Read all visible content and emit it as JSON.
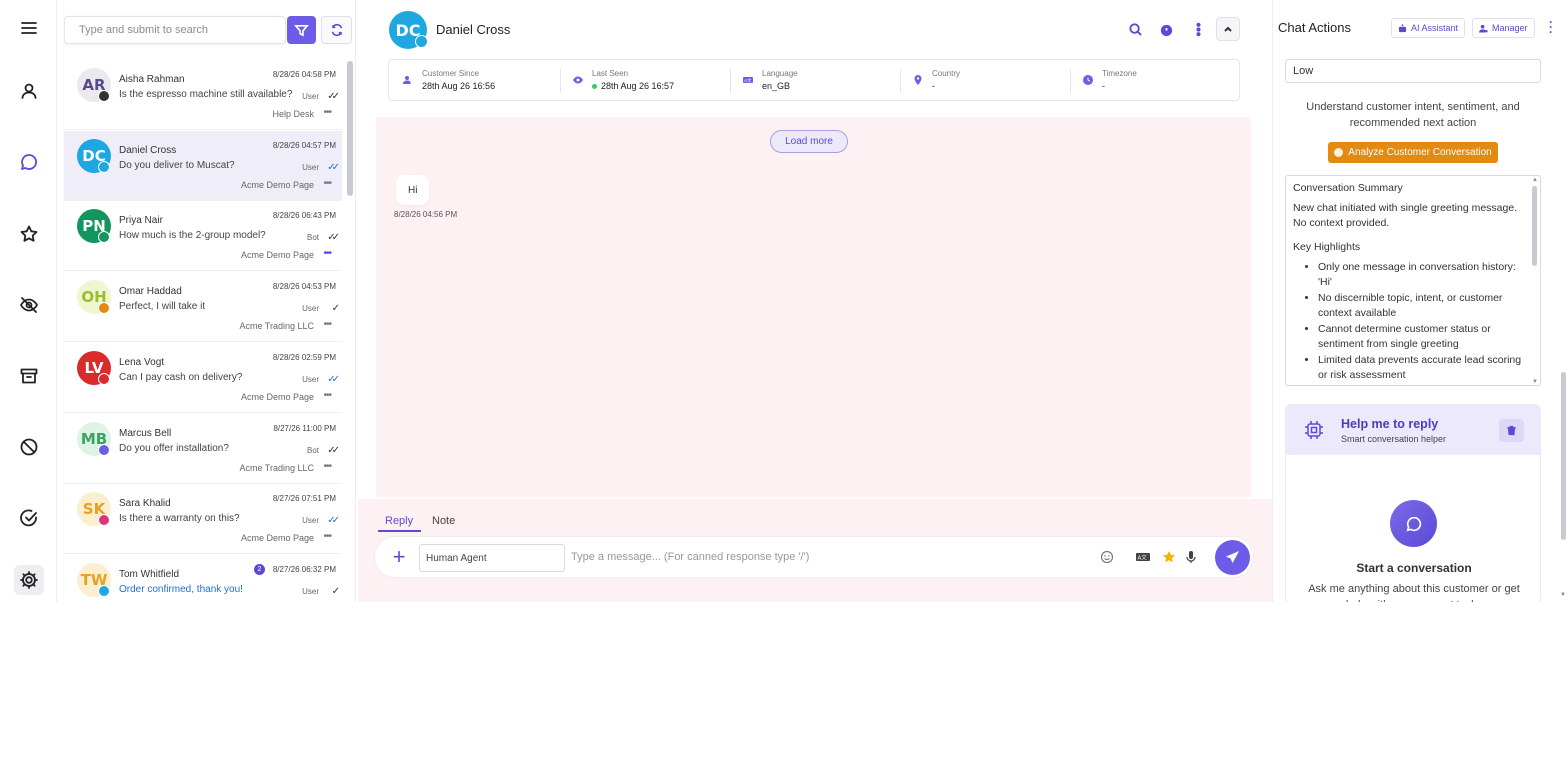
{
  "nav": {
    "items": [
      "menu-icon",
      "contacts-icon",
      "chats-icon",
      "starred-icon",
      "hidden-icon",
      "archive-icon",
      "blocked-icon",
      "resolved-icon",
      "settings-icon"
    ]
  },
  "search": {
    "placeholder": "Type and submit to search"
  },
  "conversations": [
    {
      "initials": "AR",
      "name": "Aisha Rahman",
      "time": "8/28/26 04:58 PM",
      "message": "Is the espresso machine still available?",
      "sender": "User",
      "ticks": "✓✓",
      "source": "Help Desk",
      "avatar_bg": "#e9e9ee",
      "avatar_fg": "#5b4a8a",
      "badge_bg": "#333333",
      "badge": "AR"
    },
    {
      "initials": "DC",
      "name": "Daniel Cross",
      "time": "8/28/26 04:57 PM",
      "message": "Do you deliver to Muscat?",
      "sender": "User",
      "ticks": "✓✓",
      "source": "Acme Demo Page",
      "avatar_bg": "#1ea7e0",
      "avatar_fg": "#ffffff",
      "badge_bg": "#1ea7e0",
      "badge": "DC"
    },
    {
      "initials": "PN",
      "name": "Priya Nair",
      "time": "8/28/26 06:43 PM",
      "message": "How much is the 2-group model?",
      "sender": "Bot",
      "ticks": "✓✓",
      "source": "Acme Demo Page",
      "avatar_bg": "#13955e",
      "avatar_fg": "#ffffff",
      "badge_bg": "#13955e",
      "badge": "PN"
    },
    {
      "initials": "OH",
      "name": "Omar Haddad",
      "time": "8/28/26 04:53 PM",
      "message": "Perfect, I will take it",
      "sender": "User",
      "ticks": "✓",
      "source": "Acme Trading LLC",
      "avatar_bg": "#eef7cf",
      "avatar_fg": "#9bbf2c",
      "badge_bg": "#e38a12",
      "badge": "OH"
    },
    {
      "initials": "LV",
      "name": "Lena Vogt",
      "time": "8/28/26 02:59 PM",
      "message": "Can I pay cash on delivery?",
      "sender": "User",
      "ticks": "✓✓",
      "source": "Acme Demo Page",
      "avatar_bg": "#d92b2b",
      "avatar_fg": "#ffffff",
      "badge_bg": "#d92b2b",
      "badge": "LV"
    },
    {
      "initials": "MB",
      "name": "Marcus Bell",
      "time": "8/27/26 11:00 PM",
      "message": "Do you offer installation?",
      "sender": "Bot",
      "ticks": "✓✓",
      "source": "Acme Trading LLC",
      "avatar_bg": "#dff2e6",
      "avatar_fg": "#3aa35f",
      "badge_bg": "#6c5ce7",
      "badge": "MB"
    },
    {
      "initials": "SK",
      "name": "Sara Khalid",
      "time": "8/27/26 07:51 PM",
      "message": "Is there a warranty on this?",
      "sender": "User",
      "ticks": "✓✓",
      "source": "Acme Demo Page",
      "avatar_bg": "#fcefcf",
      "avatar_fg": "#e5a224",
      "badge_bg": "#d9367a",
      "badge": "SK"
    },
    {
      "initials": "TW",
      "name": "Tom Whitfield",
      "time": "8/27/26 06:32 PM",
      "message": "Order confirmed, thank you!",
      "sender": "User",
      "ticks": "✓",
      "source": "",
      "avatar_bg": "#fcefcf",
      "avatar_fg": "#e5a224",
      "badge_bg": "#1ea7e0",
      "badge": "TW",
      "unread": "2"
    }
  ],
  "chat": {
    "initials": "DC",
    "name": "Daniel Cross",
    "info": {
      "customer_since_label": "Customer Since",
      "customer_since": "28th Aug 26 16:56",
      "last_seen_label": "Last Seen",
      "last_seen": "28th Aug 26 16:57",
      "language_label": "Language",
      "language": "en_GB",
      "country_label": "Country",
      "country": "-",
      "timezone_label": "Timezone",
      "timezone": "-"
    },
    "load_more": "Load more",
    "messages": [
      {
        "text": "Hi",
        "time": "8/28/26 04:56 PM"
      }
    ],
    "tabs": {
      "reply": "Reply",
      "note": "Note"
    },
    "agent_select": "Human Agent",
    "input_placeholder": "Type a message... (For canned response type '/')"
  },
  "panel": {
    "title": "Chat Actions",
    "ai_assistant": "AI Assistant",
    "manager": "Manager",
    "priority": "Low",
    "intent_text": "Understand customer intent, sentiment, and recommended next action",
    "analyze_button": "Analyze Customer Conversation",
    "summary_title": "Conversation Summary",
    "summary_text": "New chat initiated with single greeting message. No context provided.",
    "highlights_title": "Key Highlights",
    "highlights": [
      "Only one message in conversation history: 'Hi'",
      "No discernible topic, intent, or customer context available",
      "Cannot determine customer status or sentiment from single greeting",
      "Limited data prevents accurate lead scoring or risk assessment"
    ],
    "helper_title": "Help me to reply",
    "helper_subtitle": "Smart conversation helper",
    "helper_start": "Start a conversation",
    "helper_ask": "Ask me anything about this customer or get help with your support tasks"
  }
}
